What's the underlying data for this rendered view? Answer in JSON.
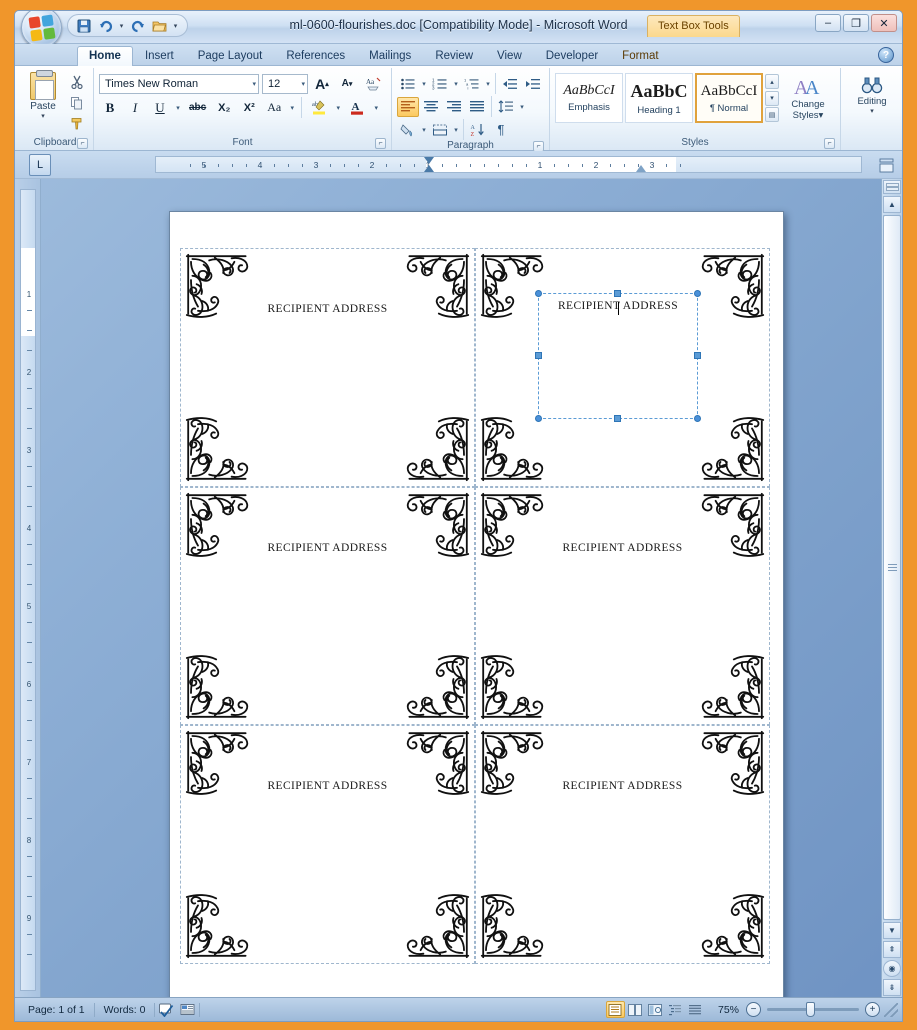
{
  "window": {
    "title": "ml-0600-flourishes.doc [Compatibility Mode] - Microsoft Word",
    "contextual_tab_title": "Text Box Tools",
    "minimize": "–",
    "restore": "❐",
    "close": "✕",
    "help": "?"
  },
  "quick_access": {
    "save": "💾",
    "undo": "↺",
    "undo_caret": "▾",
    "redo": "↻",
    "open": "📂",
    "customize": "▾"
  },
  "tabs": [
    {
      "label": "Home",
      "active": true
    },
    {
      "label": "Insert",
      "active": false
    },
    {
      "label": "Page Layout",
      "active": false
    },
    {
      "label": "References",
      "active": false
    },
    {
      "label": "Mailings",
      "active": false
    },
    {
      "label": "Review",
      "active": false
    },
    {
      "label": "View",
      "active": false
    },
    {
      "label": "Developer",
      "active": false
    },
    {
      "label": "Format",
      "active": false
    }
  ],
  "ribbon": {
    "clipboard": {
      "label": "Clipboard",
      "paste_label": "Paste",
      "paste_caret": "▾",
      "cut": "✂",
      "copy": "⧉",
      "format_painter": "🖌",
      "launcher": "⌐"
    },
    "font": {
      "label": "Font",
      "font_name": "Times New Roman",
      "font_size": "12",
      "grow_font": "A",
      "shrink_font": "A",
      "clear_formatting": "Aa",
      "bold": "B",
      "italic": "I",
      "underline": "U",
      "underline_caret": "▾",
      "strikethrough": "abc",
      "subscript": "X₂",
      "superscript": "X²",
      "change_case": "Aa",
      "change_case_caret": "▾",
      "highlight": "ab",
      "highlight_caret": "▾",
      "font_color": "A",
      "font_color_caret": "▾",
      "launcher": "⌐"
    },
    "paragraph": {
      "label": "Paragraph",
      "bullets": "☰",
      "bullets_caret": "▾",
      "numbering": "☰",
      "numbering_caret": "▾",
      "multilevel": "☰",
      "multilevel_caret": "▾",
      "decrease_indent": "⇤",
      "increase_indent": "⇥",
      "align_left": "≣",
      "align_center": "≣",
      "align_right": "≣",
      "justify": "≣",
      "line_spacing": "↕",
      "line_spacing_caret": "▾",
      "shading": "▩",
      "shading_caret": "▾",
      "borders": "▦",
      "borders_caret": "▾",
      "sort": "A↓",
      "show_marks": "¶",
      "launcher": "⌐"
    },
    "styles": {
      "label": "Styles",
      "gallery": [
        {
          "preview": "AaBbCcI",
          "name": "Emphasis",
          "selected": false
        },
        {
          "preview": "AaBbC",
          "name": "Heading 1",
          "selected": false
        },
        {
          "preview": "AaBbCcI",
          "name": "¶ Normal",
          "selected": true
        }
      ],
      "scroll_up": "▴",
      "scroll_down": "▾",
      "scroll_more": "▤",
      "change_styles_line1": "Change",
      "change_styles_line2": "Styles",
      "change_styles_caret": "▾",
      "launcher": "⌐"
    },
    "editing": {
      "label": "Editing",
      "icon": "🔍",
      "caret": "▾"
    }
  },
  "ruler": {
    "tab_stop_marker": "L",
    "horizontal_numbers": [
      "5",
      "4",
      "3",
      "2",
      "1",
      "1",
      "2",
      "3"
    ],
    "vertical_numbers": [
      "1",
      "2",
      "3",
      "4",
      "5",
      "6",
      "7",
      "8",
      "9"
    ],
    "view_ruler_toggle": "▭"
  },
  "document": {
    "cells": [
      {
        "text": "RECIPIENT ADDRESS",
        "selected": false
      },
      {
        "text": "RECIPIENT ADDRESS",
        "selected": true
      },
      {
        "text": "RECIPIENT ADDRESS",
        "selected": false
      },
      {
        "text": "RECIPIENT ADDRESS",
        "selected": false
      },
      {
        "text": "RECIPIENT ADDRESS",
        "selected": false
      },
      {
        "text": "RECIPIENT ADDRESS",
        "selected": false
      }
    ],
    "selection_color": "#5b9bd5"
  },
  "scrollbar": {
    "up_arrow": "▲",
    "down_arrow": "▼",
    "split": "▬",
    "prev_page": "⇞",
    "select_object": "◉",
    "next_page": "⇟"
  },
  "statusbar": {
    "page": "Page: 1 of 1",
    "words": "Words: 0",
    "proofing_icon": "✓",
    "language_icon": "▤",
    "views": [
      {
        "name": "print-layout",
        "glyph": "▤",
        "active": true
      },
      {
        "name": "full-screen-reading",
        "glyph": "▥",
        "active": false
      },
      {
        "name": "web-layout",
        "glyph": "▦",
        "active": false
      },
      {
        "name": "outline",
        "glyph": "▨",
        "active": false
      },
      {
        "name": "draft",
        "glyph": "▩",
        "active": false
      }
    ],
    "zoom": "75%",
    "zoom_out": "−",
    "zoom_in": "+"
  },
  "colors": {
    "frame_orange": "#f0962b",
    "ribbon_blue": "#bdd2e9",
    "accent_gold": "#fcc95f",
    "selection_blue": "#5b9bd5"
  }
}
